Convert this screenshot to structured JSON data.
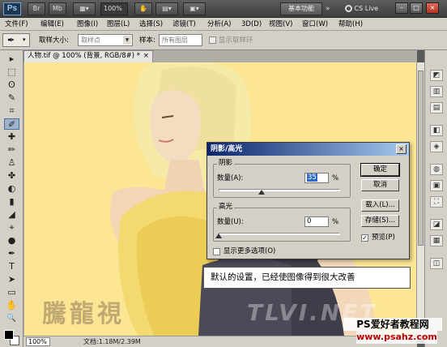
{
  "appbar": {
    "logo": "Ps",
    "zoom": "100%",
    "workspace": "基本功能",
    "cslive": "CS Live",
    "controls": [
      "–",
      "□",
      "×"
    ]
  },
  "menu": [
    "文件(F)",
    "编辑(E)",
    "图像(I)",
    "图层(L)",
    "选择(S)",
    "滤镜(T)",
    "分析(A)",
    "3D(D)",
    "视图(V)",
    "窗口(W)",
    "帮助(H)"
  ],
  "options": {
    "sample_size_label": "取样大小:",
    "sample_size_value": "取样点",
    "sample_label": "样本:",
    "sample_value": "所有图层",
    "show_ring_label": "显示取样环"
  },
  "document": {
    "tab_title": "人物.tif @ 100% (背景, RGB/8#) *",
    "tab_close": "×",
    "zoom": "100%",
    "doc_size": "文档:1.18M/2.39M"
  },
  "dialog": {
    "title": "阴影/高光",
    "close": "×",
    "shadows": {
      "group_label": "阴影",
      "amount_label": "数量(A):",
      "amount_value": "35",
      "unit": "%",
      "slider_fraction": 0.35
    },
    "highlights": {
      "group_label": "高光",
      "amount_label": "数量(U):",
      "amount_value": "0",
      "unit": "%",
      "slider_fraction": 0.0
    },
    "show_more_label": "显示更多选项(O)",
    "buttons": {
      "ok": "确定",
      "cancel": "取消",
      "load": "载入(L)...",
      "save": "存储(S)...",
      "preview": "预览(P)"
    },
    "preview_checked": "✓"
  },
  "callout": "默认的设置，已经使图像得到很大改善",
  "watermark": {
    "left": "騰龍視",
    "right": "TLVI.NET",
    "site_name": "PS爱好者教程网",
    "site_url": "www.psahz.com"
  },
  "tools": [
    "▸",
    "⬚",
    "ʘ",
    "✎",
    "⌗",
    "✐",
    "✚",
    "✏",
    "♙",
    "✤",
    "◐",
    "▮",
    "◢",
    "⌖",
    "●",
    "✒",
    "T",
    "➤",
    "▭",
    "✋",
    "🔍"
  ],
  "panel_icons": [
    "◩",
    "▥",
    "▤",
    "◧",
    "◈",
    "◍",
    "▣",
    "⛶",
    "◪",
    "▦",
    "◫"
  ],
  "colors": {
    "canvas_bg": "#fce693",
    "dialog_title_start": "#0a246a",
    "dialog_title_end": "#a6caf0"
  }
}
